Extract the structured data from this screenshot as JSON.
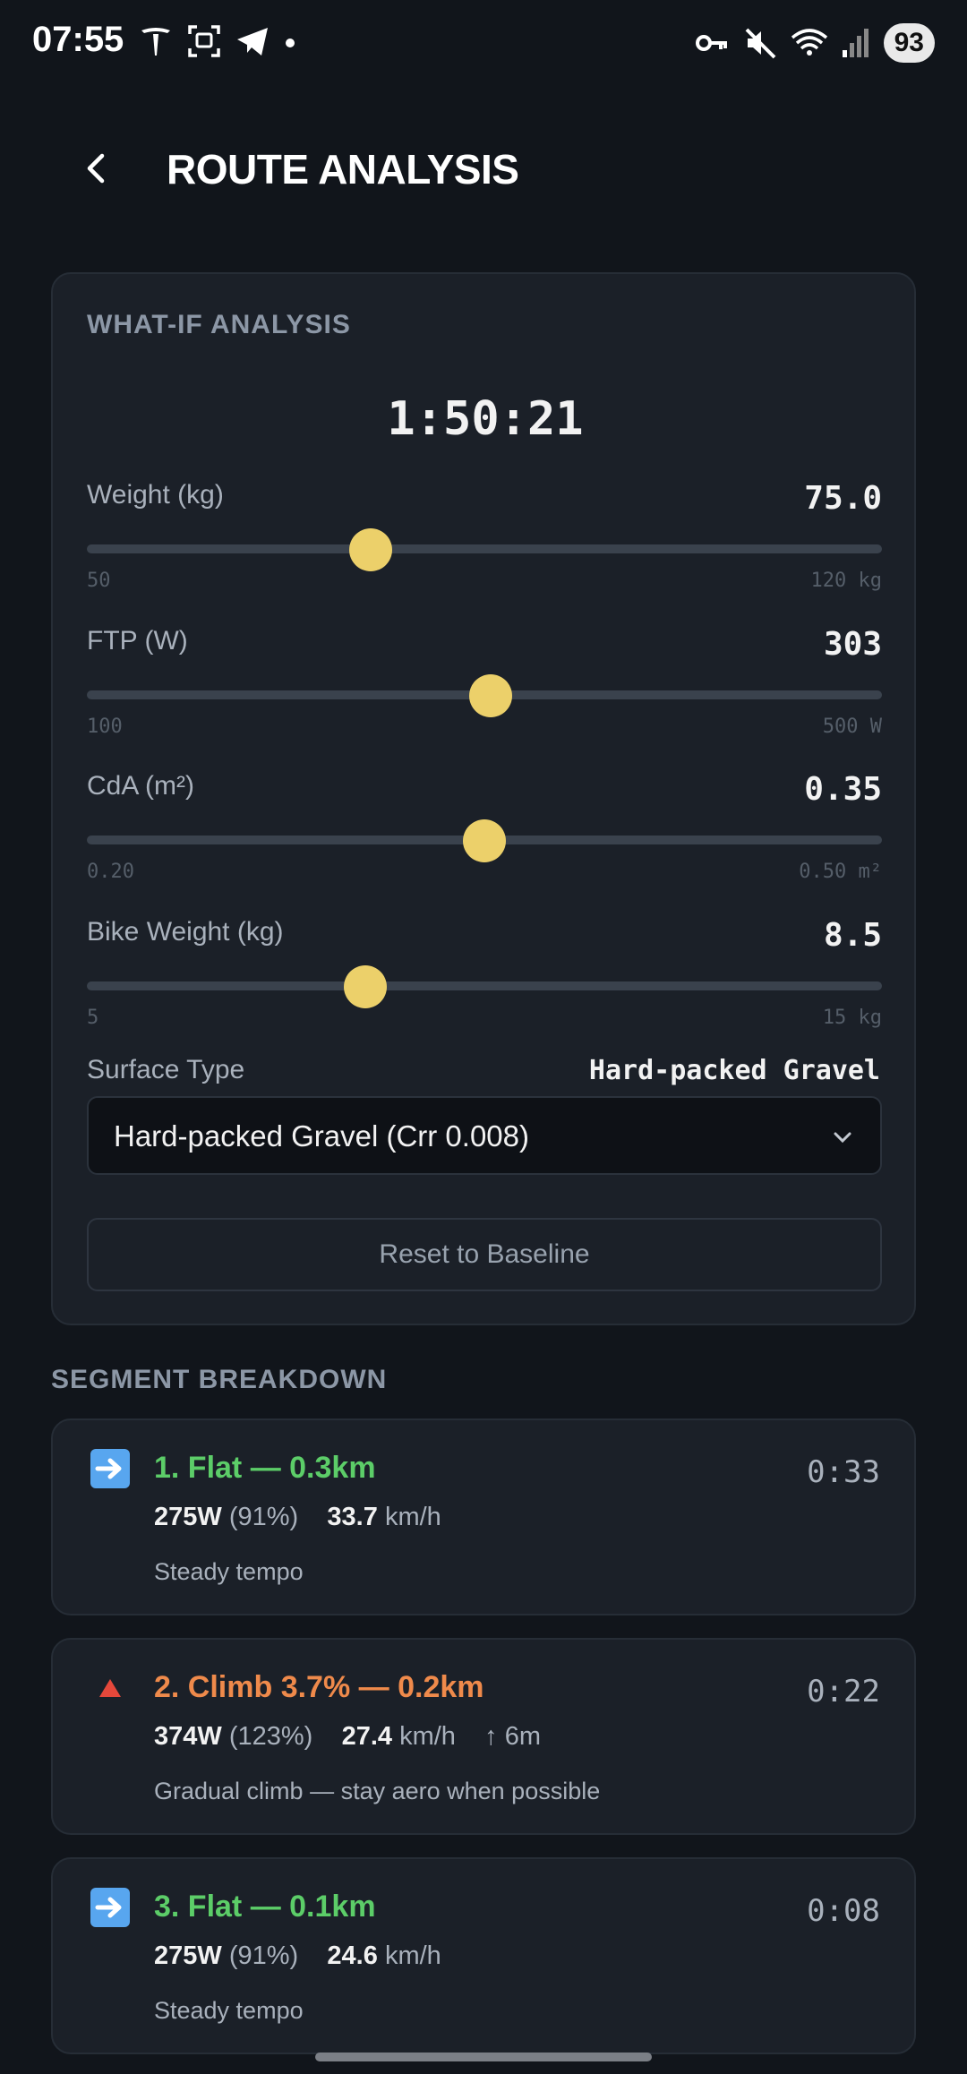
{
  "status_bar": {
    "time": "07:55",
    "battery": "93",
    "left_icons": [
      "tesla-icon",
      "screenshot-icon",
      "telegram-icon",
      "dot-icon"
    ],
    "right_icons": [
      "key-icon",
      "mute-icon",
      "wifi-icon",
      "signal-icon"
    ]
  },
  "header": {
    "title": "ROUTE ANALYSIS"
  },
  "whatif": {
    "heading": "WHAT-IF ANALYSIS",
    "total_time": "1:50:21",
    "params": [
      {
        "label": "Weight (kg)",
        "value": "75.0",
        "min_label": "50",
        "max_label": "120 kg",
        "level": 0.357
      },
      {
        "label": "FTP (W)",
        "value": "303",
        "min_label": "100",
        "max_label": "500 W",
        "level": 0.508
      },
      {
        "label": "CdA (m²)",
        "value": "0.35",
        "min_label": "0.20",
        "max_label": "0.50 m²",
        "level": 0.5
      },
      {
        "label": "Bike Weight (kg)",
        "value": "8.5",
        "min_label": "5",
        "max_label": "15 kg",
        "level": 0.35
      }
    ],
    "surface_label": "Surface Type",
    "surface_value": "Hard-packed Gravel",
    "surface_selected": "Hard-packed Gravel (Crr 0.008)",
    "reset_label": "Reset to Baseline"
  },
  "segments_heading": "SEGMENT BREAKDOWN",
  "segments": [
    {
      "icon": "right-arrow-icon",
      "title": "1. Flat — 0.3km",
      "time": "0:33",
      "power": "275W",
      "pct": "(91%)",
      "speed": "33.7",
      "speed_unit": "km/h",
      "elev": "",
      "note": "Steady tempo",
      "color": "#5ccd68"
    },
    {
      "icon": "up-triangle-icon",
      "title": "2. Climb 3.7% — 0.2km",
      "time": "0:22",
      "power": "374W",
      "pct": "(123%)",
      "speed": "27.4",
      "speed_unit": "km/h",
      "elev": "↑ 6m",
      "note": "Gradual climb — stay aero when possible",
      "color": "#ef8a4b"
    },
    {
      "icon": "right-arrow-icon",
      "title": "3. Flat — 0.1km",
      "time": "0:08",
      "power": "275W",
      "pct": "(91%)",
      "speed": "24.6",
      "speed_unit": "km/h",
      "elev": "",
      "note": "Steady tempo",
      "color": "#5ccd68"
    }
  ]
}
